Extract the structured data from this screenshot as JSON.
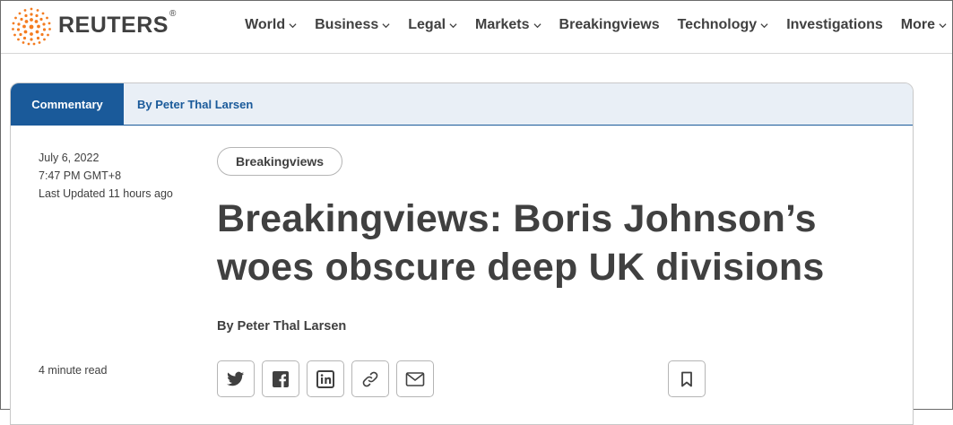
{
  "header": {
    "logo_text": "REUTERS",
    "logo_mark": "®",
    "nav": [
      {
        "label": "World",
        "has_dropdown": true
      },
      {
        "label": "Business",
        "has_dropdown": true
      },
      {
        "label": "Legal",
        "has_dropdown": true
      },
      {
        "label": "Markets",
        "has_dropdown": true
      },
      {
        "label": "Breakingviews",
        "has_dropdown": false
      },
      {
        "label": "Technology",
        "has_dropdown": true
      },
      {
        "label": "Investigations",
        "has_dropdown": false
      },
      {
        "label": "More",
        "has_dropdown": true
      }
    ]
  },
  "article": {
    "section_tag": "Commentary",
    "header_byline": "By Peter Thal Larsen",
    "date": "July 6, 2022",
    "time": "7:47 PM GMT+8",
    "updated": "Last Updated 11 hours ago",
    "category": "Breakingviews",
    "headline": "Breakingviews: Boris Johnson’s woes obscure deep UK divisions",
    "byline": "By Peter Thal Larsen",
    "read_time": "4 minute read"
  },
  "share_icons": [
    "twitter-icon",
    "facebook-icon",
    "linkedin-icon",
    "link-icon",
    "email-icon",
    "bookmark-icon"
  ],
  "colors": {
    "brand_orange": "#f47c20",
    "accent_blue": "#1a5a9a",
    "header_bg": "#e9eff6",
    "text": "#404040"
  }
}
